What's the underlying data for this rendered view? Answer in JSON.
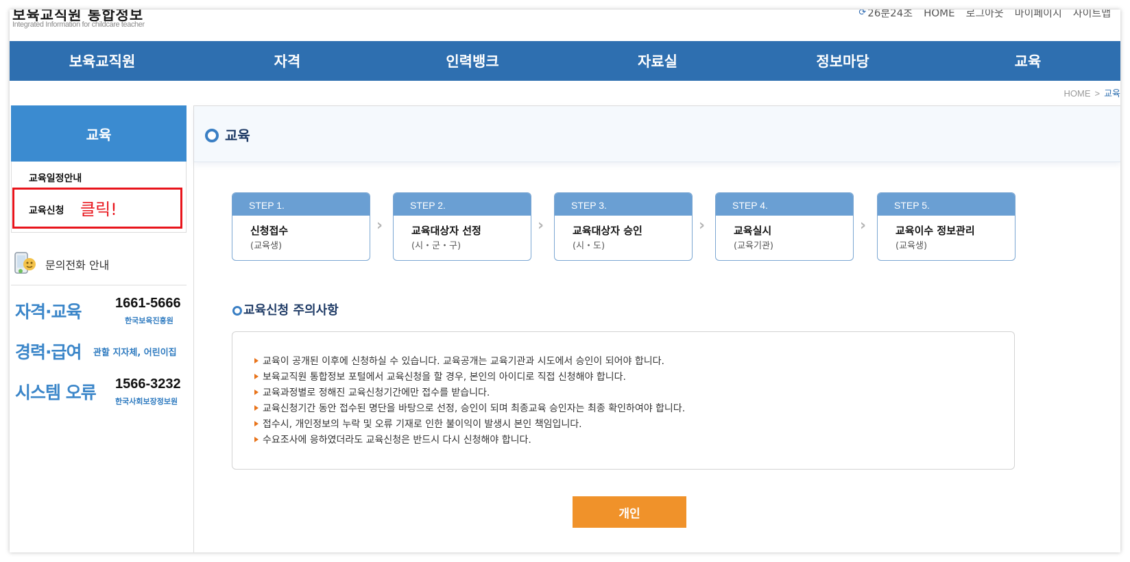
{
  "header": {
    "logo_title": "보육교직원 통합정보",
    "logo_subtitle": "Integrated Information for childcare teacher",
    "session_timer": "26분24초",
    "util_links": [
      "HOME",
      "로그아웃",
      "마이페이지",
      "사이트맵"
    ]
  },
  "gnb": {
    "items": [
      "보육교직원",
      "자격",
      "인력뱅크",
      "자료실",
      "정보마당",
      "교육"
    ],
    "color": "#2e6fb0"
  },
  "breadcrumb": {
    "home": "HOME",
    "separator": ">",
    "current": "교육"
  },
  "sidebar": {
    "title": "교육",
    "items": [
      "교육일정안내",
      "교육신청"
    ],
    "annotation": "클릭!",
    "contact": {
      "title": "문의전화 안내",
      "entries": [
        {
          "label": "자격·교육",
          "phone": "1661-5666",
          "org": "한국보육진흥원"
        },
        {
          "label": "경력·급여",
          "org": "관할 지자체, 어린이집"
        },
        {
          "label": "시스템 오류",
          "phone": "1566-3232",
          "org": "한국사회보장정보원"
        }
      ]
    }
  },
  "main": {
    "title": "교육",
    "steps": [
      {
        "step": "STEP 1.",
        "name": "신청접수",
        "sub": "(교육생)"
      },
      {
        "step": "STEP 2.",
        "name": "교육대상자 선정",
        "sub": "(시・군・구)"
      },
      {
        "step": "STEP 3.",
        "name": "교육대상자 승인",
        "sub": "(시・도)"
      },
      {
        "step": "STEP 4.",
        "name": "교육실시",
        "sub": "(교육기관)"
      },
      {
        "step": "STEP 5.",
        "name": "교육이수 정보관리",
        "sub": "(교육생)"
      }
    ],
    "notice_title": "교육신청 주의사항",
    "notices": [
      "교육이 공개된 이후에 신청하실 수 있습니다. 교육공개는 교육기관과 시도에서 승인이 되어야 합니다.",
      "보육교직원 통합정보 포털에서 교육신청을 할 경우, 본인의 아이디로 직접 신청해야 합니다.",
      "교육과정별로 정해진 교육신청기간에만 접수를 받습니다.",
      "교육신청기간 동안 접수된 명단을 바탕으로 선정, 승인이 되며 최종교육 승인자는 최종 확인하여야 합니다.",
      "접수시, 개인정보의 누락 및 오류 기재로 인한 불이익이 발생시 본인 책임입니다.",
      "수요조사에 응하였더라도 교육신청은 반드시 다시 신청해야 합니다."
    ],
    "apply_button": "개인",
    "accent_orange": "#f0922a"
  }
}
